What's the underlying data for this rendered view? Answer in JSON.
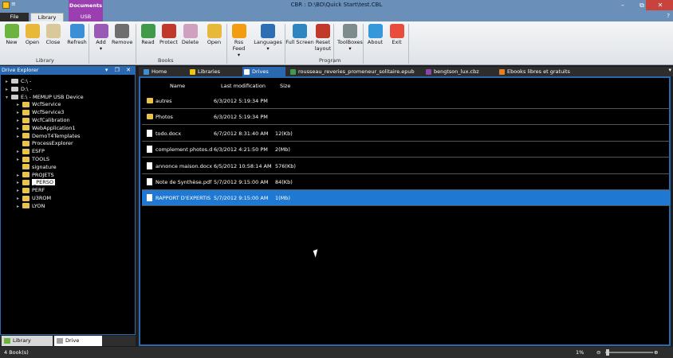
{
  "window": {
    "title": "CBR : D:\\BD\\Quick Start\\test.CBL",
    "qat_label": "≡",
    "minimize": "–",
    "restore": "⧉",
    "close": "✕"
  },
  "ribbon_tabs": {
    "file": "File",
    "library": "Library",
    "context_group": "Documents",
    "usb": "USB",
    "help_icon": "?"
  },
  "ribbon": {
    "buttons": [
      {
        "label": "New",
        "color": "#6cb33f"
      },
      {
        "label": "Open",
        "color": "#e7b83a"
      },
      {
        "label": "Close",
        "color": "#d8c89a"
      },
      {
        "label": "Refresh",
        "color": "#3a8fd6"
      },
      {
        "label": "Add",
        "color": "#9b59b6"
      },
      {
        "label": "Remove",
        "color": "#6e6e6e"
      },
      {
        "label": "Read",
        "color": "#3f9a4a"
      },
      {
        "label": "Protect",
        "color": "#c0392b"
      },
      {
        "label": "Delete",
        "color": "#d0a0c0"
      },
      {
        "label": "Open",
        "color": "#e7b83a"
      },
      {
        "label": "Rss Feed",
        "color": "#f39c12"
      },
      {
        "label": "Languages",
        "color": "#2f6db5"
      },
      {
        "label": "Full Screen",
        "color": "#2e86c1"
      },
      {
        "label": "Reset layout",
        "color": "#c0392b"
      },
      {
        "label": "ToolBoxes",
        "color": "#7f8c8d"
      },
      {
        "label": "About",
        "color": "#3498db"
      },
      {
        "label": "Exit",
        "color": "#e74c3c"
      }
    ],
    "groups": [
      "Library",
      "Books",
      "Program"
    ],
    "dropdown_arrow": "▾"
  },
  "drive_explorer": {
    "title": "Drive Explorer",
    "header_icons": "▾ ❐ ✕",
    "items": [
      {
        "label": "C:\\ -",
        "type": "drive",
        "expander": "▸"
      },
      {
        "label": "D:\\ -",
        "type": "drive",
        "expander": "▸"
      },
      {
        "label": "E:\\ - MEMUP USB Device",
        "type": "drive",
        "expander": "▾"
      },
      {
        "label": "WcfService",
        "type": "folder",
        "expander": "▸"
      },
      {
        "label": "WcfService3",
        "type": "folder",
        "expander": "▸"
      },
      {
        "label": "WcfCalibration",
        "type": "folder",
        "expander": "▸"
      },
      {
        "label": "WebApplication1",
        "type": "folder",
        "expander": "▸"
      },
      {
        "label": "DemoT4Templates",
        "type": "folder",
        "expander": "▸"
      },
      {
        "label": "ProcessExplorer",
        "type": "folder",
        "expander": ""
      },
      {
        "label": "ESFP",
        "type": "folder",
        "expander": "▸"
      },
      {
        "label": "TOOLS",
        "type": "folder",
        "expander": "▸"
      },
      {
        "label": "signature",
        "type": "folder",
        "expander": ""
      },
      {
        "label": "PROJETS",
        "type": "folder",
        "expander": "▸"
      },
      {
        "label": "_PERSO",
        "type": "folder",
        "expander": "▸",
        "selected": true
      },
      {
        "label": "PERF",
        "type": "folder",
        "expander": "▸"
      },
      {
        "label": "U3ROM",
        "type": "folder",
        "expander": "▸"
      },
      {
        "label": "LYON",
        "type": "folder",
        "expander": "▸"
      }
    ],
    "bottom_tabs": [
      "Library Explorer",
      "Drive Explorer"
    ]
  },
  "document_tabs": [
    {
      "label": "Home",
      "color": "#3a8fd6"
    },
    {
      "label": "Libraries",
      "color": "#f1c40f"
    },
    {
      "label": "Drives",
      "color": "#ffffff",
      "active": true
    },
    {
      "label": "rousseau_reveries_promeneur_solitaire.epub",
      "color": "#3f9a4a"
    },
    {
      "label": "bengtson_lux.cbz",
      "color": "#8e44ad"
    },
    {
      "label": "Ebooks libres et gratuits",
      "color": "#e67e22"
    }
  ],
  "tab_menu_arrow": "▾",
  "file_list": {
    "columns": [
      "Name",
      "Last modification",
      "Size"
    ],
    "rows": [
      {
        "name": "autres",
        "modified": "6/3/2012 5:19:34 PM",
        "size": "",
        "type": "folder"
      },
      {
        "name": "Photos",
        "modified": "6/3/2012 5:19:34 PM",
        "size": "",
        "type": "folder"
      },
      {
        "name": "todo.docx",
        "modified": "6/7/2012 8:31:40 AM",
        "size": "12(Kb)",
        "type": "file"
      },
      {
        "name": "complement photos.d",
        "modified": "6/3/2012 4:21:50 PM",
        "size": "2(Mb)",
        "type": "file"
      },
      {
        "name": "annonce maison.docx",
        "modified": "6/5/2012 10:58:14 AM",
        "size": "576(Kb)",
        "type": "file"
      },
      {
        "name": "Note de Synthèse.pdf",
        "modified": "5/7/2012 9:15:00 AM",
        "size": "84(Kb)",
        "type": "file"
      },
      {
        "name": "RAPPORT D'EXPERTIS",
        "modified": "5/7/2012 9:15:00 AM",
        "size": "1(Mb)",
        "type": "file",
        "selected": true
      }
    ]
  },
  "status": {
    "book_count": "4 Book(s)",
    "zoom": "1%",
    "zoom_out": "⊖",
    "zoom_in": "⊕",
    "zoom_level": 0.02
  }
}
